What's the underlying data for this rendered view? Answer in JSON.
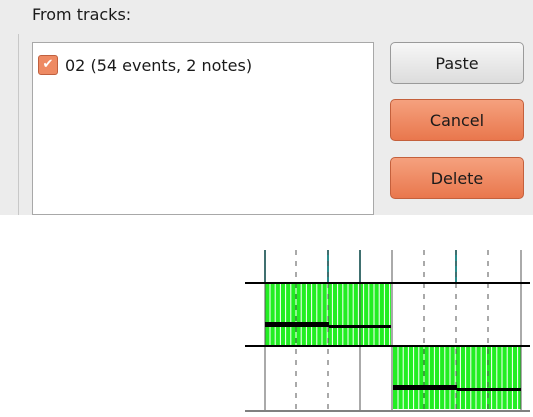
{
  "dialog": {
    "group_label": "From tracks:",
    "tracks": [
      {
        "label": "02 (54 events, 2 notes)",
        "checked": true
      }
    ],
    "checkbox_glyph": "✔",
    "buttons": {
      "paste": "Paste",
      "cancel": "Cancel",
      "delete": "Delete"
    },
    "colors": {
      "accent_button": "#ec845a",
      "checkbox": "#ee8a63",
      "panel": "#ececec"
    }
  },
  "preview": {
    "kind": "piano-roll",
    "lanes": 2,
    "notes": [
      {
        "lane": 1,
        "segment": 1,
        "velocity_level": "lower-mid"
      },
      {
        "lane": 2,
        "segment": 2,
        "velocity_level": "low"
      }
    ],
    "colors": {
      "event_fill": "#22ee22",
      "event_tick": "#ffffff",
      "note_bar": "#000000",
      "lane_rule": "#000000",
      "marker": "#2a8c8c",
      "grid": "#555555"
    }
  }
}
